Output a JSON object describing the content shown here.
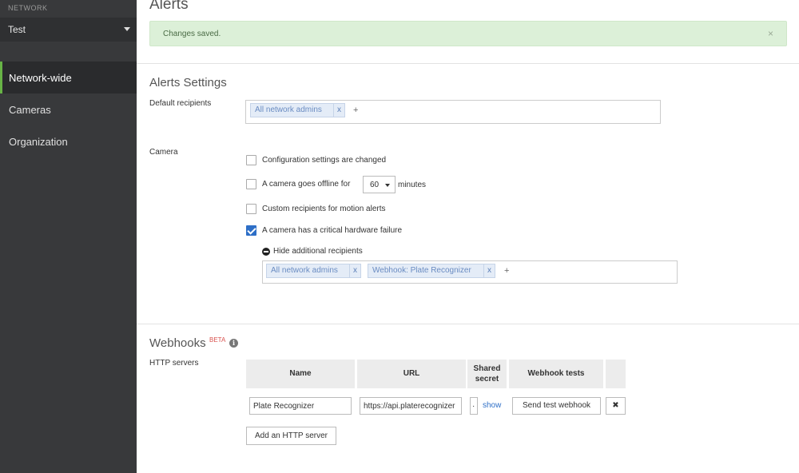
{
  "sidebar": {
    "heading": "NETWORK",
    "network_name": "Test",
    "items": [
      {
        "label": "Network-wide",
        "active": true
      },
      {
        "label": "Cameras",
        "active": false
      },
      {
        "label": "Organization",
        "active": false
      }
    ]
  },
  "page": {
    "title": "Alerts",
    "flash_message": "Changes saved.",
    "flash_close": "×"
  },
  "alerts_settings": {
    "title": "Alerts Settings",
    "default_recipients_label": "Default recipients",
    "default_recipients": [
      {
        "label": "All network admins",
        "remove": "x"
      }
    ],
    "add_symbol": "+",
    "camera_label": "Camera",
    "camera_options": [
      {
        "label": "Configuration settings are changed",
        "checked": false
      },
      {
        "label_before": "A camera goes offline for",
        "select_value": "60",
        "label_after": "minutes",
        "checked": false
      },
      {
        "label": "Custom recipients for motion alerts",
        "checked": false
      },
      {
        "label": "A camera has a critical hardware failure",
        "checked": true
      }
    ],
    "hide_additional": "Hide additional recipients",
    "additional_recipients": [
      {
        "label": "All network admins",
        "remove": "x"
      },
      {
        "label": "Webhook: Plate Recognizer",
        "remove": "x"
      }
    ]
  },
  "webhooks": {
    "title": "Webhooks",
    "beta": "BETA",
    "info_icon": "i",
    "http_servers_label": "HTTP servers",
    "columns": {
      "name": "Name",
      "url": "URL",
      "shared_secret_line1": "Shared",
      "shared_secret_line2": "secret",
      "tests": "Webhook tests"
    },
    "row": {
      "name": "Plate Recognizer",
      "url": "https://api.platerecognizer",
      "secret": "·",
      "show": "show",
      "send_test": "Send test webhook",
      "delete": "✖"
    },
    "add_server": "Add an HTTP server"
  },
  "colors": {
    "sidebar_bg": "#38393b",
    "active_accent": "#67b346",
    "flash_bg": "#dcf0d8",
    "link": "#2e6fc7",
    "tag_bg": "#e4ecf7"
  }
}
